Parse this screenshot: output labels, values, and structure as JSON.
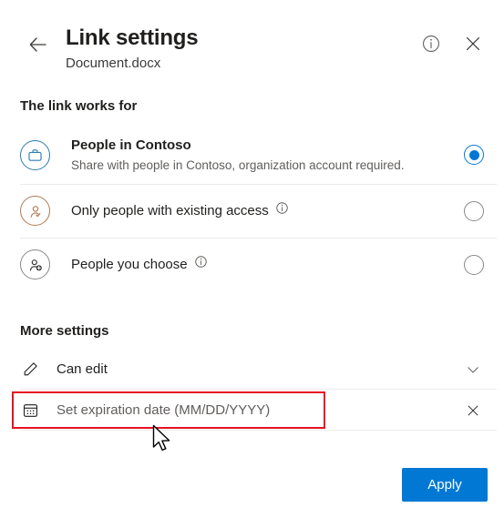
{
  "header": {
    "title": "Link settings",
    "subtitle": "Document.docx",
    "back_icon": "back-arrow-icon",
    "info_icon": "info-circle-icon",
    "close_icon": "close-icon"
  },
  "link_works_for": {
    "heading": "The link works for",
    "options": [
      {
        "icon": "briefcase-circle-icon",
        "title": "People in Contoso",
        "description": "Share with people in Contoso, organization account required.",
        "has_info_icon": false,
        "selected": true
      },
      {
        "icon": "person-check-circle-icon",
        "title": "Only people with existing access",
        "description": "",
        "has_info_icon": true,
        "selected": false
      },
      {
        "icon": "person-add-circle-icon",
        "title": "People you choose",
        "description": "",
        "has_info_icon": true,
        "selected": false
      }
    ]
  },
  "more_settings": {
    "heading": "More settings",
    "permission_row": {
      "icon": "pencil-icon",
      "label": "Can edit",
      "trailing_icon": "chevron-down-icon"
    },
    "expiration_row": {
      "icon": "calendar-icon",
      "placeholder": "Set expiration date (MM/DD/YYYY)",
      "value": "",
      "trailing_icon": "close-icon"
    }
  },
  "footer": {
    "apply_label": "Apply"
  },
  "annotation": {
    "highlight_color": "#e81123",
    "target": "expiration-date-field"
  },
  "colors": {
    "accent": "#0078d4",
    "contoso_icon": "#2b7cb3",
    "existing_access_icon": "#b07a55",
    "people_choose_icon": "#8a8886",
    "divider": "#edebe9",
    "text_primary": "#201f1e",
    "text_secondary": "#605e5c"
  }
}
